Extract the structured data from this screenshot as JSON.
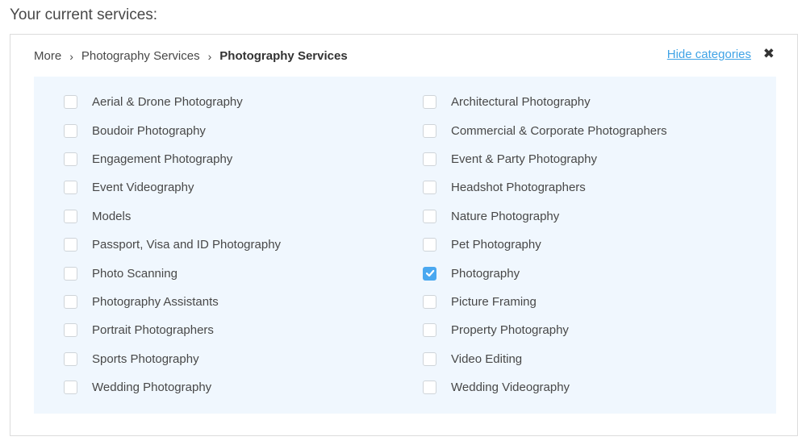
{
  "heading": "Your current services:",
  "breadcrumb": {
    "items": [
      "More",
      "Photography Services"
    ],
    "current": "Photography Services",
    "separator": "›"
  },
  "actions": {
    "hide_categories": "Hide categories",
    "close_symbol": "✖"
  },
  "colors": {
    "accent": "#4aa8f0",
    "link": "#3fa3e6",
    "panel_bg": "#f0f7fe"
  },
  "categories_left": [
    {
      "label": "Aerial & Drone Photography",
      "checked": false
    },
    {
      "label": "Boudoir Photography",
      "checked": false
    },
    {
      "label": "Engagement Photography",
      "checked": false
    },
    {
      "label": "Event Videography",
      "checked": false
    },
    {
      "label": "Models",
      "checked": false
    },
    {
      "label": "Passport, Visa and ID Photography",
      "checked": false
    },
    {
      "label": "Photo Scanning",
      "checked": false
    },
    {
      "label": "Photography Assistants",
      "checked": false
    },
    {
      "label": "Portrait Photographers",
      "checked": false
    },
    {
      "label": "Sports Photography",
      "checked": false
    },
    {
      "label": "Wedding Photography",
      "checked": false
    }
  ],
  "categories_right": [
    {
      "label": "Architectural Photography",
      "checked": false
    },
    {
      "label": "Commercial & Corporate Photographers",
      "checked": false
    },
    {
      "label": "Event & Party Photography",
      "checked": false
    },
    {
      "label": "Headshot Photographers",
      "checked": false
    },
    {
      "label": "Nature Photography",
      "checked": false
    },
    {
      "label": "Pet Photography",
      "checked": false
    },
    {
      "label": "Photography",
      "checked": true
    },
    {
      "label": "Picture Framing",
      "checked": false
    },
    {
      "label": "Property Photography",
      "checked": false
    },
    {
      "label": "Video Editing",
      "checked": false
    },
    {
      "label": "Wedding Videography",
      "checked": false
    }
  ]
}
